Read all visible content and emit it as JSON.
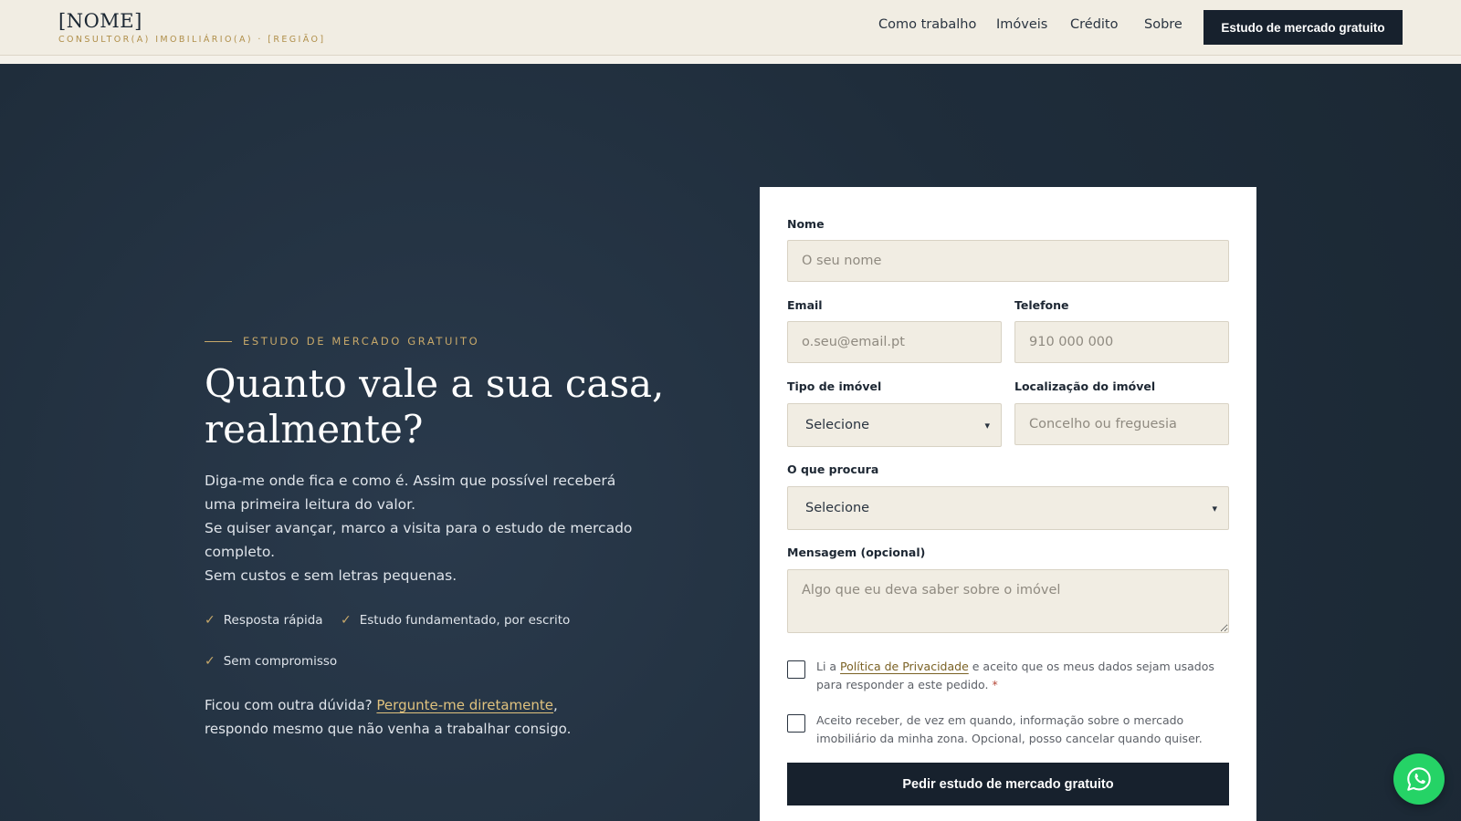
{
  "header": {
    "brand_name": "[NOME]",
    "brand_sub": "CONSULTOR(A) IMOBILIÁRIO(A) · [REGIÃO]",
    "nav": [
      "Como trabalho",
      "Imóveis",
      "Crédito",
      "Sobre"
    ],
    "cta": "Estudo de mercado gratuito"
  },
  "hero": {
    "eyebrow": "ESTUDO DE MERCADO GRATUITO",
    "headline": [
      "Quanto vale a sua casa,",
      "realmente?"
    ],
    "lead": [
      "Diga-me onde fica e como é. Assim que possível receberá uma primeira leitura do valor.",
      "Se quiser avançar, marco a visita para o estudo de mercado completo.",
      "Sem custos e sem letras pequenas."
    ],
    "bullets": [
      "Resposta rápida",
      "Estudo fundamentado, por escrito",
      "Sem compromisso"
    ],
    "note_before": "Ficou com outra dúvida? ",
    "note_link": "Pergunte-me diretamente",
    "note_after": ", respondo mesmo que não venha a trabalhar consigo."
  },
  "form": {
    "name_label": "Nome",
    "name_placeholder": "O seu nome",
    "email_label": "Email",
    "email_placeholder": "o.seu@email.pt",
    "phone_label": "Telefone",
    "phone_placeholder": "910 000 000",
    "type_label": "Tipo de imóvel",
    "type_value": "Selecione",
    "location_label": "Localização do imóvel",
    "location_placeholder": "Concelho ou freguesia",
    "seek_label": "O que procura",
    "seek_value": "Selecione",
    "message_label": "Mensagem (opcional)",
    "message_placeholder": "Algo que eu deva saber sobre o imóvel",
    "privacy_before": "Li a ",
    "privacy_link": "Política de Privacidade",
    "privacy_after": " e aceito que os meus dados sejam usados para responder a este pedido.",
    "required_mark": "*",
    "newsletter": "Aceito receber, de vez em quando, informação sobre o mercado imobiliário da minha zona. Opcional, posso cancelar quando quiser.",
    "submit": "Pedir estudo de mercado gratuito"
  },
  "icons": {
    "check": "check-icon",
    "chevron": "chevron-down-icon",
    "whatsapp": "whatsapp-icon"
  },
  "colors": {
    "navy": "#1f2d3b",
    "gold": "#c7a86a",
    "cream": "#f1ede3",
    "button": "#17212d",
    "whatsapp": "#25d366"
  }
}
